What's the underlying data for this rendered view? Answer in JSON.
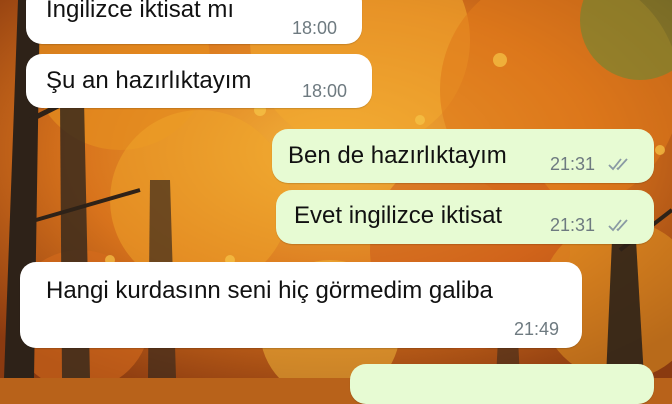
{
  "wallpaper": {
    "description_colors": [
      "#c4561a",
      "#e08a1e",
      "#f0b030",
      "#3a2a1c",
      "#6a8a3a"
    ]
  },
  "messages": [
    {
      "direction": "incoming",
      "text": "İngilizce iktisat mı",
      "time": "18:00"
    },
    {
      "direction": "incoming",
      "text": "Şu an hazırlıktayım",
      "time": "18:00"
    },
    {
      "direction": "outgoing",
      "text": "Ben de hazırlıktayım",
      "time": "21:31",
      "status": "read"
    },
    {
      "direction": "outgoing",
      "text": "Evet ingilizce iktisat",
      "time": "21:31",
      "status": "read"
    },
    {
      "direction": "incoming",
      "text": "Hangi kurdasınn seni hiç görmedim galiba",
      "time": "21:49"
    }
  ],
  "colors": {
    "incoming_bubble": "#ffffff",
    "outgoing_bubble": "#e7fbd3",
    "time_text": "#6e7a80",
    "read_ticks": "#8a9aa4"
  }
}
